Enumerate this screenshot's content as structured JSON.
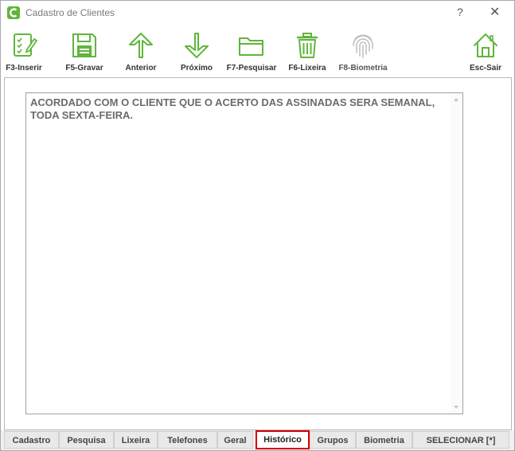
{
  "window": {
    "title": "Cadastro de Clientes",
    "help_label": "?",
    "close_label": "✕"
  },
  "toolbar": {
    "items": [
      {
        "label": "F3-Inserir",
        "icon": "edit-document-icon"
      },
      {
        "label": "F5-Gravar",
        "icon": "save-disk-icon"
      },
      {
        "label": "Anterior",
        "icon": "arrow-up-icon"
      },
      {
        "label": "Próximo",
        "icon": "arrow-down-icon"
      },
      {
        "label": "F7-Pesquisar",
        "icon": "folder-icon"
      },
      {
        "label": "F6-Lixeira",
        "icon": "trash-icon"
      },
      {
        "label": "F8-Biometria",
        "icon": "fingerprint-icon"
      },
      {
        "label": "Esc-Sair",
        "icon": "home-icon"
      }
    ],
    "icon_color": "#5fb63a",
    "disabled_icon_color": "#bdbdbd"
  },
  "historico": {
    "text": "ACORDADO COM O CLIENTE QUE O ACERTO DAS ASSINADAS SERA SEMANAL, TODA SEXTA-FEIRA."
  },
  "tabs": {
    "items": [
      "Cadastro",
      "Pesquisa",
      "Lixeira",
      "Telefones",
      "Geral",
      "Histórico",
      "Grupos",
      "Biometria"
    ],
    "active": "Histórico",
    "highlight_color": "#d40000",
    "select_label": "SELECIONAR [*]"
  }
}
